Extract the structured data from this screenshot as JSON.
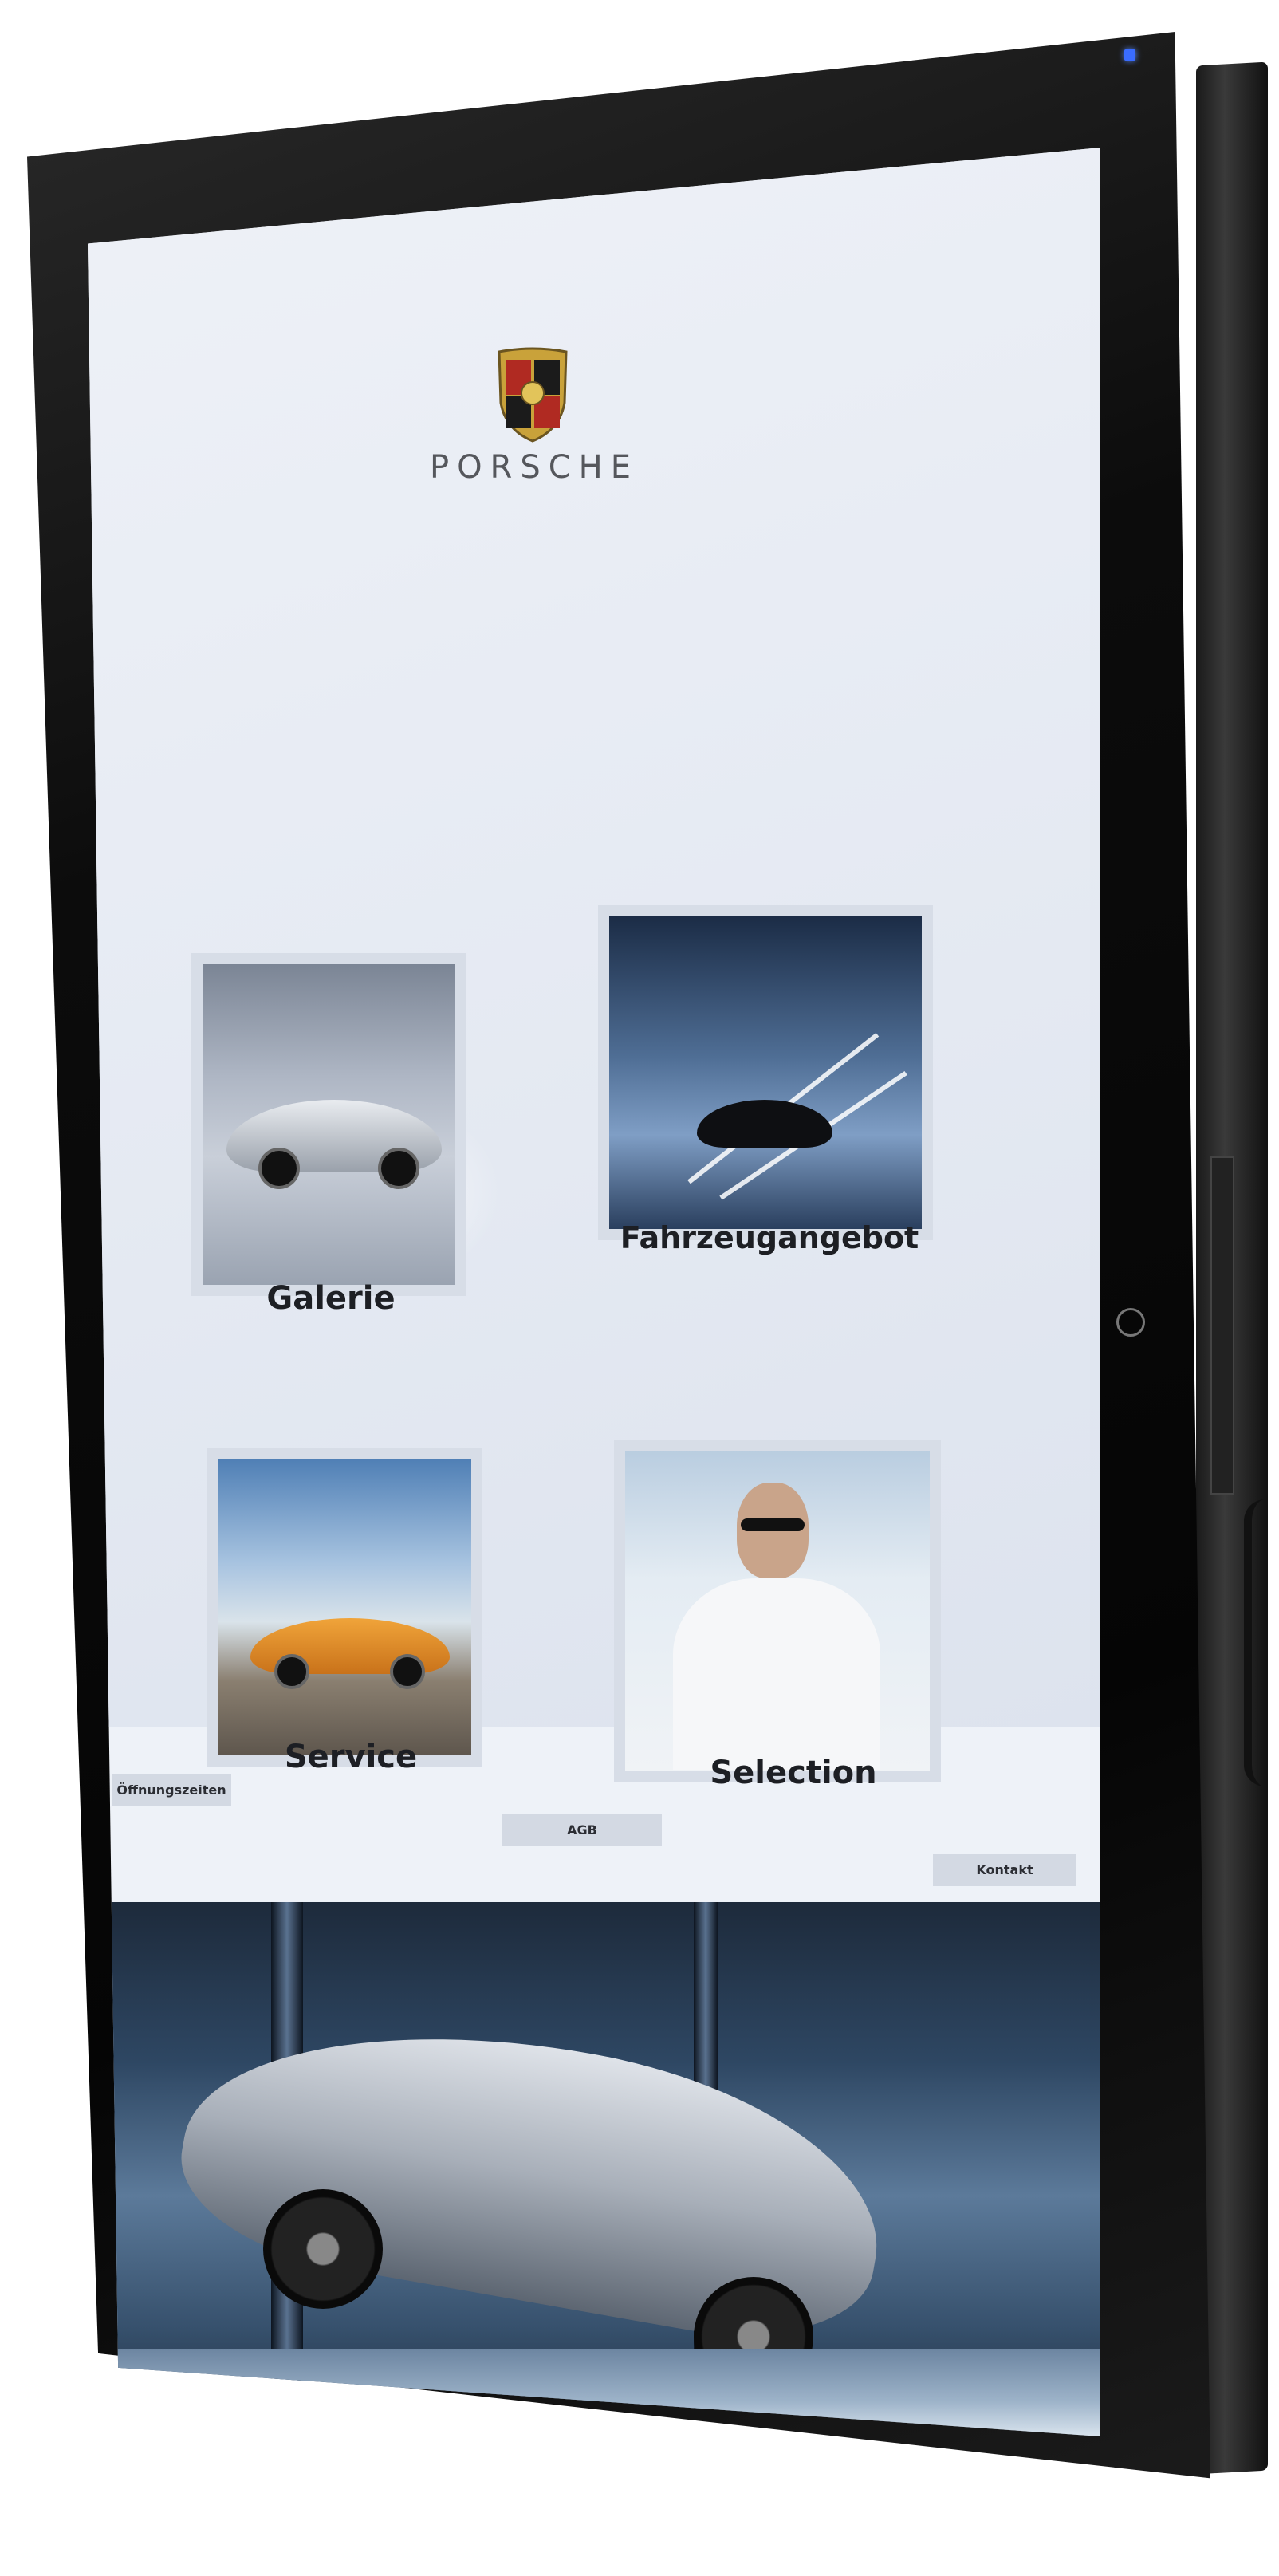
{
  "brand": {
    "name": "PORSCHE",
    "crest_icon": "porsche-crest-icon"
  },
  "tiles": [
    {
      "id": "gallery",
      "label": "Galerie"
    },
    {
      "id": "offer",
      "label": "Fahrzeugangebot"
    },
    {
      "id": "service",
      "label": "Service"
    },
    {
      "id": "selection",
      "label": "Selection"
    }
  ],
  "footer_nav": {
    "hours": "Öffnungszeiten",
    "agb": "AGB",
    "contact": "Kontakt"
  },
  "colors": {
    "screen_bg": "#eef2f8",
    "tile_bg": "#d7dde7",
    "label_text": "#1d1f24",
    "bezel": "#0c0c0c",
    "power_led": "#3a6cff"
  }
}
